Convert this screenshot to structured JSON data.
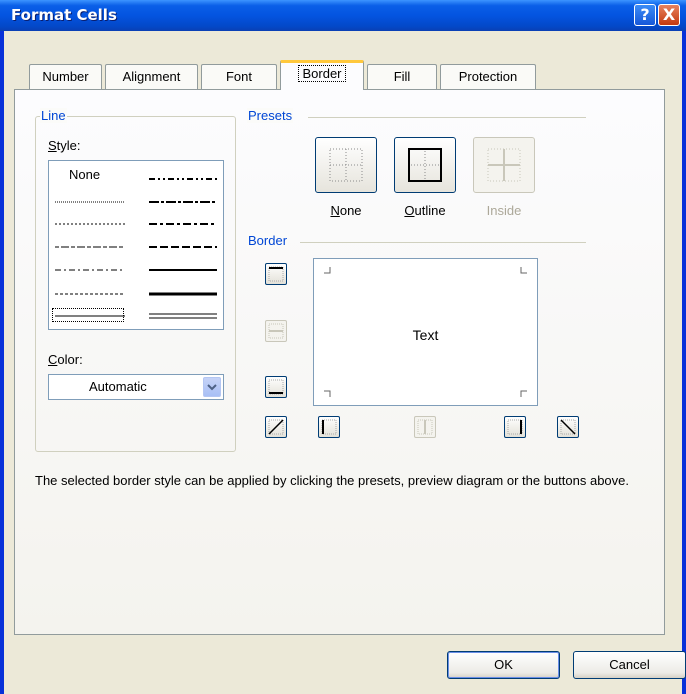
{
  "window": {
    "title": "Format Cells",
    "help_label": "?",
    "close_label": "X"
  },
  "tabs": [
    {
      "label": "Number",
      "active": false
    },
    {
      "label": "Alignment",
      "active": false
    },
    {
      "label": "Font",
      "active": false
    },
    {
      "label": "Border",
      "active": true
    },
    {
      "label": "Fill",
      "active": false
    },
    {
      "label": "Protection",
      "active": false
    }
  ],
  "line": {
    "group_label": "Line",
    "style_label": "Style:",
    "style_none": "None",
    "color_label": "Color:",
    "color_value": "Automatic"
  },
  "presets": {
    "group_label": "Presets",
    "items": [
      {
        "label": "None",
        "enabled": true
      },
      {
        "label": "Outline",
        "enabled": true
      },
      {
        "label": "Inside",
        "enabled": false
      }
    ]
  },
  "border": {
    "group_label": "Border",
    "preview_text": "Text"
  },
  "info_text": "The selected border style can be applied by clicking the presets, preview diagram or the buttons above.",
  "buttons": {
    "ok": "OK",
    "cancel": "Cancel"
  },
  "colors": {
    "titlebar": "#0454e0",
    "group_label": "#0046d5",
    "active_tab_accent": "#ffc83c",
    "dialog_face": "#ece9d8"
  }
}
